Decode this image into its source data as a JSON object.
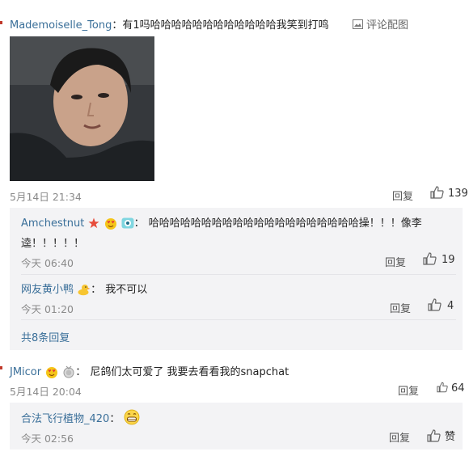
{
  "comment1": {
    "username": "Mademoiselle_Tong",
    "text": "有1吗哈哈哈哈哈哈哈哈哈哈哈哈我笑到打鸣",
    "comment_with_image_label": "评论配图",
    "time": "5月14日 21:34",
    "reply_label": "回复",
    "likes": "139",
    "replies": [
      {
        "username": "Amchestnut",
        "text_line1": "哈哈哈哈哈哈哈哈哈哈哈哈哈哈哈哈哈哈哈哈操！！！像李",
        "text_line2": "逵！！！！！",
        "time": "今天 06:40",
        "reply_label": "回复",
        "likes": "19"
      },
      {
        "username": "网友黄小鸭",
        "text": "我不可以",
        "time": "今天 01:20",
        "reply_label": "回复",
        "likes": "4"
      }
    ],
    "more_replies": "共8条回复"
  },
  "comment2": {
    "username": "JMicor",
    "text": "尼鸽们太可爱了 我要去看看我的snapchat",
    "time": "5月14日 20:04",
    "reply_label": "回复",
    "likes": "64",
    "replies": [
      {
        "username": "合法飞行植物_420",
        "time": "今天 02:56",
        "reply_label": "回复",
        "likes": "赞"
      }
    ]
  },
  "colors": {
    "name": "#3a6f99",
    "thread_bg": "#f3f3f5",
    "meta": "#8a8a8a"
  },
  "icons": [
    "image-icon",
    "thumbs-up-icon",
    "star-badge-icon",
    "heart-eyes-emoji-icon",
    "eye-badge-icon",
    "duck-emoji-icon",
    "medal-icon",
    "grin-emoji-icon"
  ]
}
